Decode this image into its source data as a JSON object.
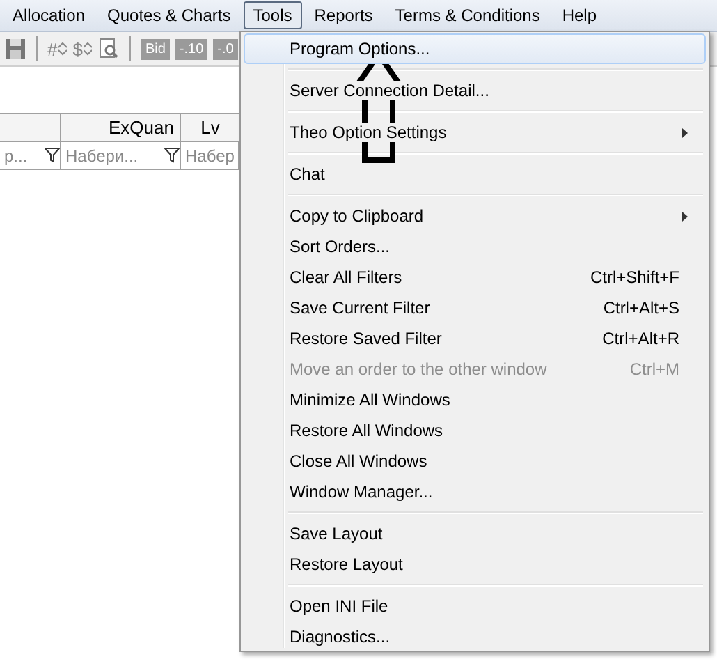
{
  "menubar": [
    {
      "label": "Allocation",
      "selected": false
    },
    {
      "label": "Quotes & Charts",
      "selected": false
    },
    {
      "label": "Tools",
      "selected": true
    },
    {
      "label": "Reports",
      "selected": false
    },
    {
      "label": "Terms & Conditions",
      "selected": false
    },
    {
      "label": "Help",
      "selected": false
    }
  ],
  "toolbar": [
    {
      "kind": "save"
    },
    {
      "kind": "separator"
    },
    {
      "kind": "spin",
      "label": "#"
    },
    {
      "kind": "spin",
      "label": "$"
    },
    {
      "kind": "preview"
    },
    {
      "kind": "separator"
    },
    {
      "kind": "chip",
      "label": "Bid"
    },
    {
      "kind": "chip",
      "label": "-.10"
    },
    {
      "kind": "chip",
      "label": "-.0"
    }
  ],
  "grid": {
    "columns": [
      {},
      {
        "label": "ExQuan"
      },
      {
        "label": "Lv"
      }
    ],
    "filters": [
      {
        "placeholder": "р..."
      },
      {
        "placeholder": "Набери..."
      },
      {
        "placeholder": "Набер"
      }
    ]
  },
  "menu": [
    {
      "kind": "item",
      "label": "Program Options...",
      "selected": true,
      "disabled": false
    },
    {
      "kind": "separator"
    },
    {
      "kind": "item",
      "label": "Server Connection Detail...",
      "selected": false,
      "disabled": false
    },
    {
      "kind": "separator"
    },
    {
      "kind": "item",
      "label": "Theo Option Settings",
      "submenu": true,
      "selected": false,
      "disabled": false
    },
    {
      "kind": "separator"
    },
    {
      "kind": "item",
      "label": "Chat",
      "selected": false,
      "disabled": false
    },
    {
      "kind": "separator"
    },
    {
      "kind": "item",
      "label": "Copy to Clipboard",
      "submenu": true,
      "selected": false,
      "disabled": false
    },
    {
      "kind": "item",
      "label": "Sort Orders...",
      "selected": false,
      "disabled": false
    },
    {
      "kind": "item",
      "label": "Clear All Filters",
      "shortcut": "Ctrl+Shift+F",
      "selected": false,
      "disabled": false
    },
    {
      "kind": "item",
      "label": "Save Current Filter",
      "shortcut": "Ctrl+Alt+S",
      "selected": false,
      "disabled": false
    },
    {
      "kind": "item",
      "label": "Restore Saved Filter",
      "shortcut": "Ctrl+Alt+R",
      "selected": false,
      "disabled": false
    },
    {
      "kind": "item",
      "label": "Move an order to the other window",
      "shortcut": "Ctrl+M",
      "selected": false,
      "disabled": true
    },
    {
      "kind": "item",
      "label": "Minimize All Windows",
      "selected": false,
      "disabled": false
    },
    {
      "kind": "item",
      "label": "Restore All Windows",
      "selected": false,
      "disabled": false
    },
    {
      "kind": "item",
      "label": "Close All Windows",
      "selected": false,
      "disabled": false
    },
    {
      "kind": "item",
      "label": "Window Manager...",
      "selected": false,
      "disabled": false
    },
    {
      "kind": "separator"
    },
    {
      "kind": "item",
      "label": "Save Layout",
      "selected": false,
      "disabled": false
    },
    {
      "kind": "item",
      "label": "Restore Layout",
      "selected": false,
      "disabled": false
    },
    {
      "kind": "separator"
    },
    {
      "kind": "item",
      "label": "Open INI File",
      "selected": false,
      "disabled": false
    },
    {
      "kind": "item",
      "label": "Diagnostics...",
      "selected": false,
      "disabled": false
    }
  ]
}
